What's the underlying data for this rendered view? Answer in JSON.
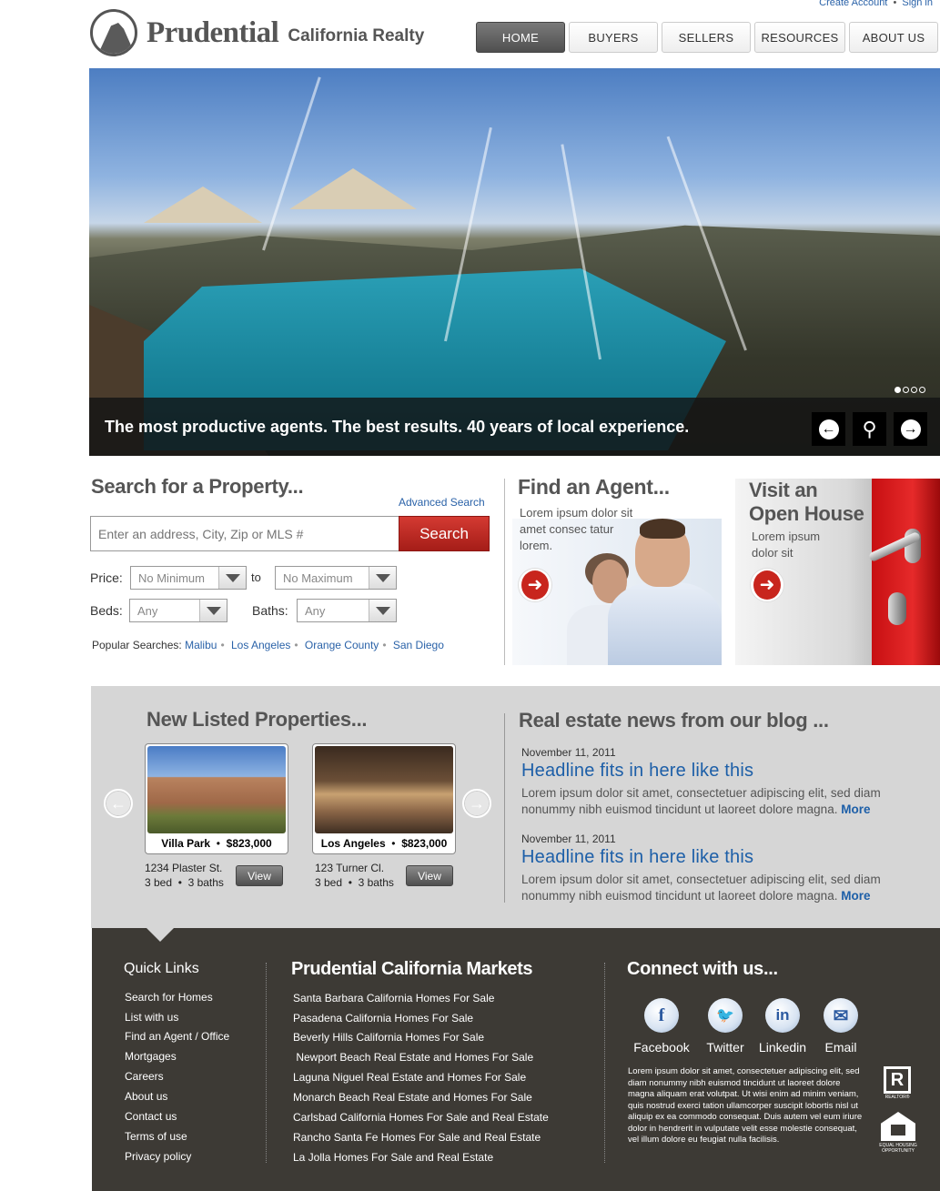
{
  "top_links": {
    "create_account": "Create Account",
    "sep": "•",
    "sign_in": "Sign in"
  },
  "brand": {
    "name": "Prudential",
    "sub": "California Realty"
  },
  "nav": [
    {
      "label": "HOME",
      "active": true
    },
    {
      "label": "BUYERS",
      "active": false
    },
    {
      "label": "SELLERS",
      "active": false
    },
    {
      "label": "RESOURCES",
      "active": false
    },
    {
      "label": "ABOUT US",
      "active": false
    }
  ],
  "hero": {
    "caption": "The most productive agents. The best results. 40 years of local experience.",
    "slides": 4,
    "active_slide": 1,
    "prev_icon": "left-arrow-icon",
    "zoom_icon": "magnifier-icon",
    "next_icon": "right-arrow-icon"
  },
  "search": {
    "title": "Search for a Property...",
    "advanced": "Advanced Search",
    "placeholder": "Enter an address, City, Zip or MLS #",
    "button": "Search",
    "price_label": "Price:",
    "price_min": "No Minimum",
    "to": "to",
    "price_max": "No Maximum",
    "beds_label": "Beds:",
    "beds_value": "Any",
    "baths_label": "Baths:",
    "baths_value": "Any",
    "popular_label": "Popular Searches:",
    "popular": [
      "Malibu",
      "Los Angeles",
      "Orange County",
      "San Diego"
    ]
  },
  "agent": {
    "title": "Find an Agent...",
    "text": "Lorem ipsum dolor sit amet consec tatur lorem."
  },
  "open_house": {
    "title_line1": "Visit an",
    "title_line2": "Open House",
    "text": "Lorem ipsum dolor sit"
  },
  "listings": {
    "title": "New Listed Properties...",
    "items": [
      {
        "city": "Villa Park",
        "price": "$823,000",
        "address": "1234 Plaster St.",
        "specs": "3 bed  •  3 baths",
        "view": "View"
      },
      {
        "city": "Los Angeles",
        "price": "$823,000",
        "address": "123 Turner Cl.",
        "specs": "3 bed  •  3 baths",
        "view": "View"
      }
    ]
  },
  "blog": {
    "title": "Real estate news from our blog ...",
    "posts": [
      {
        "date": "November 11, 2011",
        "headline": "Headline fits in here like this",
        "body": "Lorem ipsum dolor sit amet, consectetuer adipiscing elit, sed diam nonummy nibh euismod tincidunt ut laoreet dolore magna.",
        "more": "More"
      },
      {
        "date": "November 11, 2011",
        "headline": "Headline fits in here like this",
        "body": "Lorem ipsum dolor sit amet, consectetuer adipiscing elit, sed diam nonummy nibh euismod tincidunt ut laoreet dolore magna.",
        "more": "More"
      }
    ]
  },
  "footer": {
    "quick_links_title": "Quick Links",
    "quick_links": [
      "Search for Homes",
      "List with us",
      "Find an Agent / Office",
      "Mortgages",
      "Careers",
      "About us",
      "Contact us",
      "Terms of use",
      "Privacy policy"
    ],
    "markets_title": "Prudential California Markets",
    "markets": [
      "Santa Barbara California Homes For Sale",
      "Pasadena California Homes For Sale",
      "Beverly Hills California Homes For Sale",
      " Newport Beach Real Estate and Homes For Sale",
      "Laguna Niguel Real Estate and Homes For Sale",
      "Monarch Beach Real Estate and Homes For Sale",
      "Carlsbad California Homes For Sale and Real Estate",
      "Rancho Santa Fe Homes For Sale and Real Estate",
      "La Jolla Homes For Sale and Real Estate"
    ],
    "connect_title": "Connect with us...",
    "social": [
      {
        "label": "Facebook",
        "glyph": "f",
        "icon": "facebook-icon"
      },
      {
        "label": "Twitter",
        "glyph": "🐦",
        "icon": "twitter-icon"
      },
      {
        "label": "Linkedin",
        "glyph": "in",
        "icon": "linkedin-icon"
      },
      {
        "label": "Email",
        "glyph": "✉",
        "icon": "email-icon"
      }
    ],
    "legal": "Lorem ipsum dolor sit amet, consectetuer adipiscing elit, sed diam nonummy nibh euismod tincidunt ut laoreet dolore magna aliquam erat volutpat. Ut wisi enim ad minim veniam, quis nostrud exerci tation ullamcorper suscipit lobortis nisl ut aliquip ex ea commodo consequat. Duis autem vel eum iriure dolor in hendrerit in vulputate velit esse molestie consequat, vel illum dolore eu feugiat nulla facilisis.",
    "realtor_letter": "R",
    "realtor_label": "REALTOR®",
    "eho_label": "EQUAL HOUSING OPPORTUNITY"
  }
}
